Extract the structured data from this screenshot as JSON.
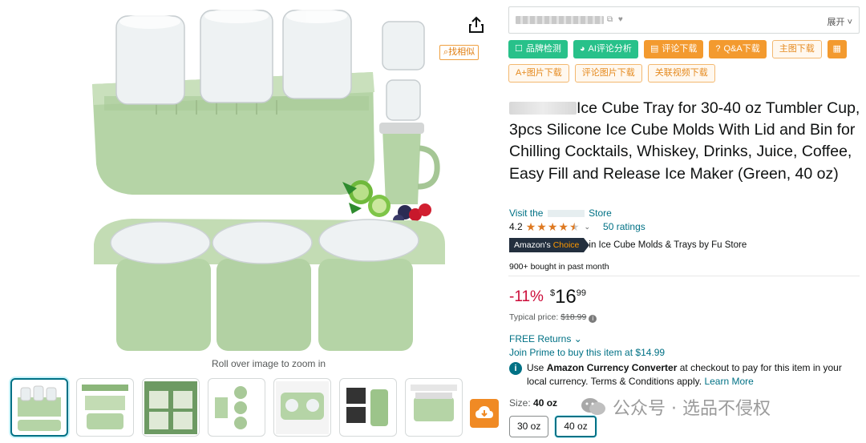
{
  "gallery": {
    "zoom_hint": "Roll over image to zoom in",
    "find_similar": "找相似",
    "thumbnail_count": 7
  },
  "plugin": {
    "search_expand": "展开",
    "row1": [
      "品牌检测",
      "AI评论分析",
      "评论下载",
      "Q&A下载",
      "主图下载"
    ],
    "row2": [
      "A+图片下载",
      "评论图片下载",
      "关联视频下载"
    ]
  },
  "product": {
    "title": "Ice Cube Tray for 30-40 oz Tumbler Cup, 3pcs Silicone Ice Cube Molds With Lid and Bin for Chilling Cocktails, Whiskey, Drinks, Juice, Coffee, Easy Fill and Release Ice Maker (Green, 40 oz)",
    "store_prefix": "Visit the",
    "store_suffix": "Store",
    "rating": "4.2",
    "ratings_count": "50 ratings",
    "badge_amazons": "Amazon's",
    "badge_choice": "Choice",
    "badge_category": "in Ice Cube Molds & Trays by Fu Store",
    "bought": "900+ bought in past month"
  },
  "price": {
    "discount": "-11%",
    "currency": "$",
    "whole": "16",
    "fraction": "99",
    "typical_label": "Typical price:",
    "typical_value": "$18.99"
  },
  "delivery": {
    "returns": "FREE Returns",
    "prime": "Join Prime to buy this item at $14.99",
    "note_pre": "Use ",
    "note_bold": "Amazon Currency Converter",
    "note_post": " at checkout to pay for this item in your local currency. Terms & Conditions apply. ",
    "learn_more": "Learn More"
  },
  "size": {
    "label": "Size:",
    "selected": "40 oz",
    "options": [
      "30 oz",
      "40 oz"
    ]
  },
  "watermark": {
    "text": "公众号 · 选品不侵权"
  },
  "colors": {
    "link": "#007185",
    "deal": "#cc0c39",
    "star": "#de7921",
    "plugin_green": "#28c18a",
    "plugin_orange": "#f39a2f"
  }
}
